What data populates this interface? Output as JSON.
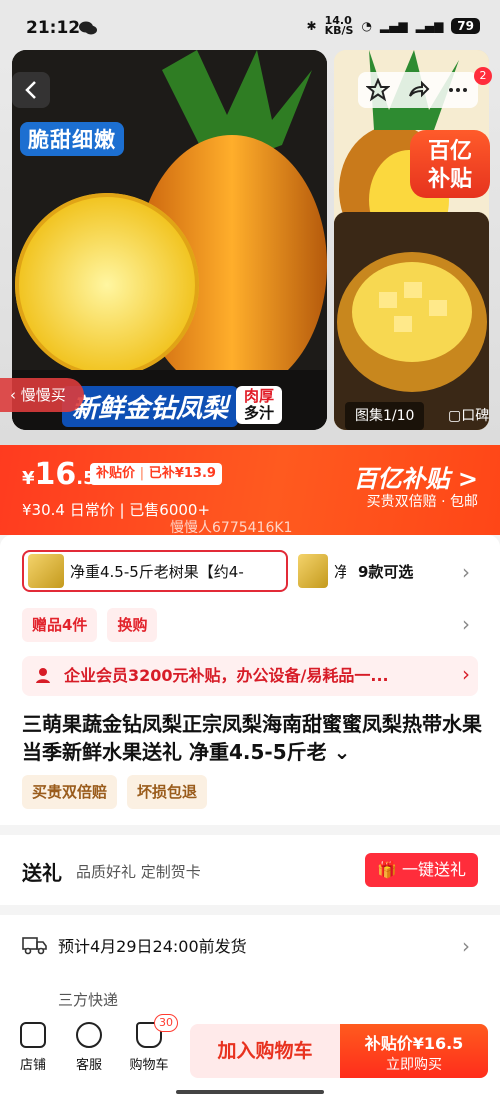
{
  "status_bar": {
    "time": "21:12",
    "net_speed": "14.0\nKB/S",
    "battery": "79"
  },
  "gallery": {
    "tag_top": "脆甜细嫩",
    "banner_name": "新鲜金钻凤梨",
    "banner_juicy_1": "肉厚",
    "banner_juicy_2": "多汁",
    "slow_buy": "慢慢买",
    "count": "图集1/10",
    "tail": "口碑",
    "brand_tile_1": "百亿",
    "brand_tile_2": "补贴",
    "share_badge": "2"
  },
  "price": {
    "currency": "¥",
    "int": "16",
    "dec": ".5",
    "subsidy_label": "补贴价",
    "subsidy_sep": " | ",
    "subsidy_amount": "已补¥13.9",
    "daily": "¥30.4 日常价 | 已售6000+",
    "brand": "百亿补贴 >",
    "guarantee": "买贵双倍赔 · 包邮",
    "ghost": "慢慢人6775416K1"
  },
  "sku": {
    "selected": "净重4.5-5斤老树果【约4-",
    "next": "净重",
    "more": "9款可选"
  },
  "gifts": {
    "chip1": "赠品4件",
    "chip2": "换购"
  },
  "promo": {
    "text": "企业会员3200元补贴，办公设备/易耗品一..."
  },
  "title": "三萌果蔬金钻凤梨正宗凤梨海南甜蜜蜜凤梨热带水果当季新鲜水果送礼 净重4.5-5斤老",
  "tags": [
    "买贵双倍赔",
    "坏损包退"
  ],
  "gift_card": {
    "label": "送礼",
    "sub": "品质好礼 定制贺卡",
    "button": "一键送礼"
  },
  "shipping": {
    "eta": "预计4月29日24:00前发货",
    "carrier": "三方快递"
  },
  "bottom_bar": {
    "shop": "店铺",
    "service": "客服",
    "cart": "购物车",
    "cart_count": "30",
    "add_to_cart": "加入购物车",
    "buy_price": "补贴价¥16.5",
    "buy_now": "立即购买"
  },
  "colors": {
    "brand_red": "#ff3b1f",
    "accent": "#e2232c"
  }
}
